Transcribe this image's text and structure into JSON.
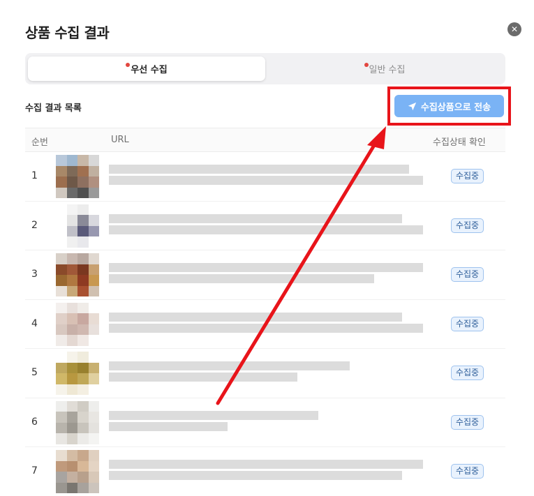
{
  "modal": {
    "title": "상품 수집 결과",
    "close_icon": "close-icon"
  },
  "tabs": [
    {
      "label": "우선 수집",
      "active": true,
      "has_dot": true
    },
    {
      "label": "일반 수집",
      "active": false,
      "has_dot": true
    }
  ],
  "list": {
    "title": "수집 결과 목록",
    "send_button_label": "수집상품으로 전송",
    "send_button_icon": "send-icon"
  },
  "table": {
    "columns": [
      "순번",
      "URL",
      "수집상태 확인"
    ],
    "rows": [
      {
        "num": "1",
        "status": "수집중"
      },
      {
        "num": "2",
        "status": "수집중"
      },
      {
        "num": "3",
        "status": "수집중"
      },
      {
        "num": "4",
        "status": "수집중"
      },
      {
        "num": "5",
        "status": "수집중"
      },
      {
        "num": "6",
        "status": "수집중"
      },
      {
        "num": "7",
        "status": "수집중"
      }
    ]
  },
  "colors": {
    "accent_button": "#7ab3f5",
    "highlight_box": "#e8141a",
    "annotation_arrow": "#e8141a",
    "status_badge": "#e9f2fd",
    "tab_dot": "#e2463f"
  }
}
